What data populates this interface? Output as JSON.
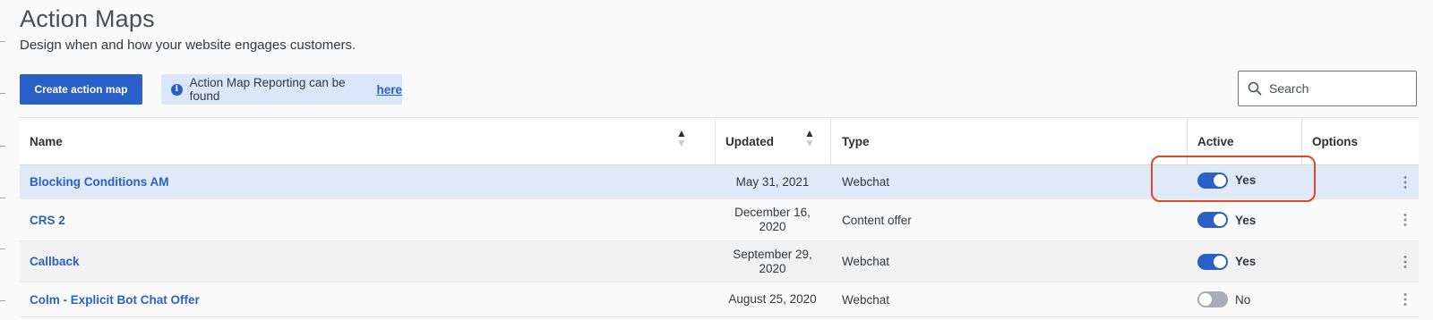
{
  "page": {
    "title": "Action Maps",
    "subtitle": "Design when and how your website engages customers."
  },
  "toolbar": {
    "create_label": "Create action map",
    "info_text": "Action Map Reporting can be found",
    "info_link": "here",
    "search_placeholder": "Search"
  },
  "table": {
    "columns": {
      "name": "Name",
      "updated": "Updated",
      "type": "Type",
      "active": "Active",
      "options": "Options"
    },
    "rows": [
      {
        "name": "Blocking Conditions AM",
        "updated": "May 31, 2021",
        "type": "Webchat",
        "active": true,
        "active_label": "Yes",
        "selected": true
      },
      {
        "name": "CRS 2",
        "updated": "December 16, 2020",
        "type": "Content offer",
        "active": true,
        "active_label": "Yes",
        "selected": false
      },
      {
        "name": "Callback",
        "updated": "September 29, 2020",
        "type": "Webchat",
        "active": true,
        "active_label": "Yes",
        "selected": false
      },
      {
        "name": "Colm - Explicit Bot Chat Offer",
        "updated": "August 25, 2020",
        "type": "Webchat",
        "active": false,
        "active_label": "No",
        "selected": false
      }
    ]
  },
  "icons": {
    "info": "info-icon",
    "search": "search-icon",
    "sort": "sort-icon",
    "more": "more-vertical-icon"
  },
  "colors": {
    "accent": "#2a60c8",
    "selected_row": "#e0e9f8",
    "toggle_off": "#a7adb3",
    "highlight": "#e0452e"
  }
}
